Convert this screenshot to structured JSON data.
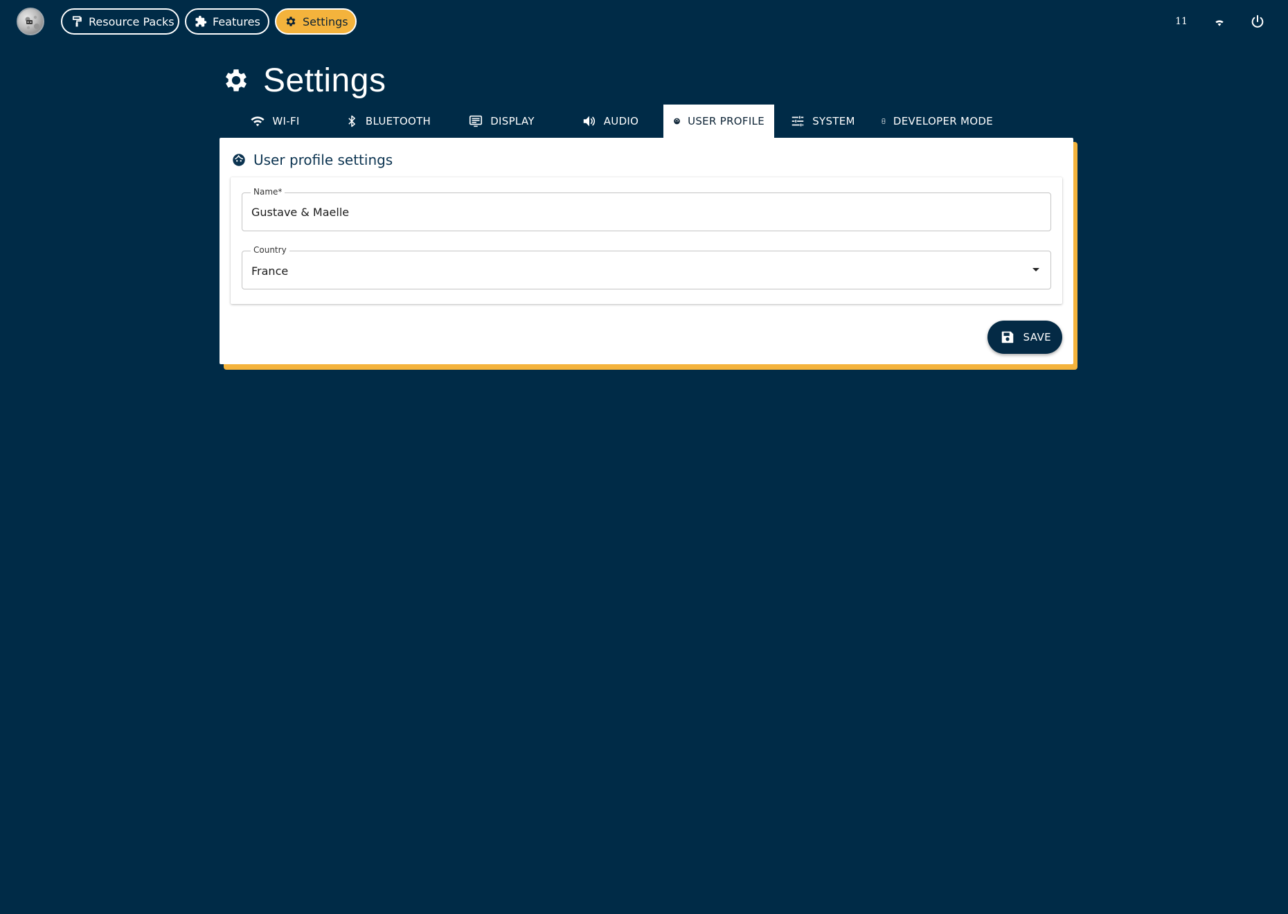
{
  "topbar": {
    "nav": [
      {
        "label": "Resource Packs",
        "icon": "paint-roller-icon"
      },
      {
        "label": "Features",
        "icon": "puzzle-icon"
      },
      {
        "label": "Settings",
        "icon": "gear-icon",
        "active": true
      }
    ],
    "clock": "11",
    "icons": [
      "wifi-icon",
      "power-icon"
    ]
  },
  "heading": {
    "title": "Settings",
    "icon": "gear-icon"
  },
  "tabs": [
    {
      "label": "WI-FI",
      "icon": "wifi-icon"
    },
    {
      "label": "BLUETOOTH",
      "icon": "bluetooth-icon"
    },
    {
      "label": "DISPLAY",
      "icon": "display-icon"
    },
    {
      "label": "AUDIO",
      "icon": "speaker-icon"
    },
    {
      "label": "USER PROFILE",
      "icon": "face-icon",
      "active": true
    },
    {
      "label": "SYSTEM",
      "icon": "sliders-icon"
    },
    {
      "label": "DEVELOPER MODE",
      "icon": "developer-mode-icon"
    }
  ],
  "card": {
    "title": "User profile settings",
    "fields": {
      "name": {
        "label": "Name*",
        "value": "Gustave & Maelle"
      },
      "country": {
        "label": "Country",
        "value": "France"
      }
    },
    "save_label": "SAVE"
  },
  "colors": {
    "background": "#002b47",
    "accent": "#f4b33c",
    "button": "#042a45"
  }
}
